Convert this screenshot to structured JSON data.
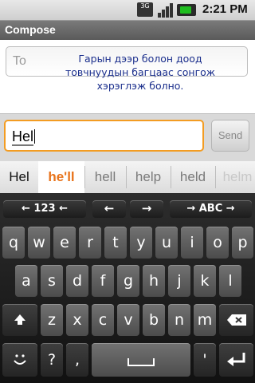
{
  "status": {
    "network_type": "3G",
    "time": "2:21 PM"
  },
  "app": {
    "title": "Compose"
  },
  "recipient": {
    "label": "To"
  },
  "overlay_text": [
    "Гарын дээр болон доод",
    "товчнуудын багцаас сонгож",
    "хэрэглэж болно."
  ],
  "message": {
    "value": "Hel"
  },
  "send": {
    "label": "Send"
  },
  "suggestions": [
    "Hel",
    "he'll",
    "hell",
    "help",
    "held",
    "helm"
  ],
  "keyboard": {
    "top_row": [
      "← 123 ←",
      "←",
      "→",
      "→ ABC →"
    ],
    "row1": [
      "q",
      "w",
      "e",
      "r",
      "t",
      "y",
      "u",
      "i",
      "o",
      "p"
    ],
    "row2": [
      "a",
      "s",
      "d",
      "f",
      "g",
      "h",
      "j",
      "k",
      "l"
    ],
    "row3": [
      "z",
      "x",
      "c",
      "v",
      "b",
      "n",
      "m"
    ],
    "row4": [
      "?",
      ",",
      "'"
    ]
  }
}
